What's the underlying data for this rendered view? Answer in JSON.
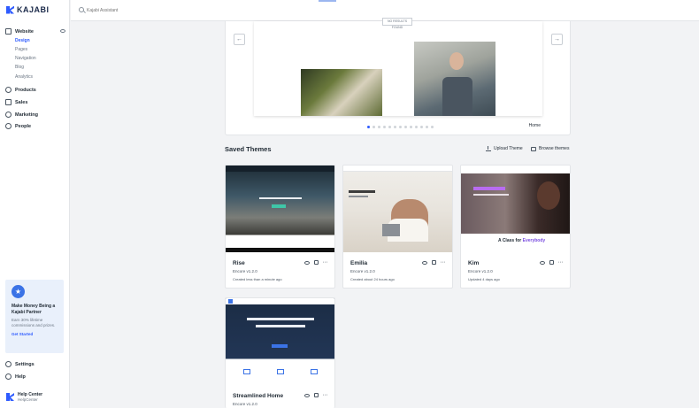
{
  "brand": {
    "name": "KAJABI",
    "accent": "#2e5bff"
  },
  "search": {
    "placeholder": "Kajabi Assistant"
  },
  "sidebar": {
    "website": {
      "label": "Website",
      "subitems": [
        {
          "label": "Design",
          "active": true
        },
        {
          "label": "Pages"
        },
        {
          "label": "Navigation"
        },
        {
          "label": "Blog"
        },
        {
          "label": "Analytics"
        }
      ]
    },
    "items": [
      {
        "label": "Products"
      },
      {
        "label": "Sales"
      },
      {
        "label": "Marketing"
      },
      {
        "label": "People"
      }
    ],
    "promo": {
      "badge": "★",
      "title": "Make Money Being a Kajabi Partner",
      "body": "Earn 30% lifetime commissions and prizes.",
      "link": "Get Started"
    },
    "bottom": [
      {
        "label": "Settings"
      },
      {
        "label": "Help"
      }
    ],
    "help_center": {
      "title": "Help Center",
      "subtitle": "HelpCenter"
    }
  },
  "carousel": {
    "tag": "NO RESULTS FOUND",
    "current_label": "Home",
    "prev": "←",
    "next": "→",
    "dots": 13,
    "active_dot": 0
  },
  "saved_themes": {
    "title": "Saved Themes",
    "upload_label": "Upload Theme",
    "browse_label": "Browse themes",
    "themes": [
      {
        "name": "Rise",
        "version": "Encore v1.2.0",
        "created": "Created less than a minute ago"
      },
      {
        "name": "Emilia",
        "version": "Encore v1.2.0",
        "created": "Created about 24 hours ago"
      },
      {
        "name": "Kim",
        "version": "Encore v1.2.0",
        "created": "Updated 4 days ago",
        "caption_pre": "A Class for ",
        "caption_accent": "Everybody"
      },
      {
        "name": "Streamlined Home",
        "version": "Encore v1.2.0"
      }
    ],
    "more_glyph": "···"
  }
}
